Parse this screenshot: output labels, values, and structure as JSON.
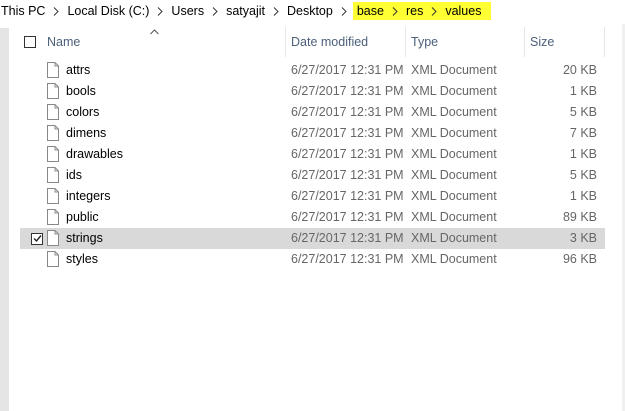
{
  "breadcrumb": {
    "items": [
      "This PC",
      "Local Disk (C:)",
      "Users",
      "satyajit",
      "Desktop",
      "base",
      "res",
      "values"
    ],
    "highlight_color": "#ffff33"
  },
  "columns": {
    "name": "Name",
    "date": "Date modified",
    "type": "Type",
    "size": "Size"
  },
  "sort": {
    "column": "name",
    "direction": "ascending"
  },
  "files": [
    {
      "name": "attrs",
      "date": "6/27/2017 12:31 PM",
      "type": "XML Document",
      "size": "20 KB",
      "selected": false
    },
    {
      "name": "bools",
      "date": "6/27/2017 12:31 PM",
      "type": "XML Document",
      "size": "1 KB",
      "selected": false
    },
    {
      "name": "colors",
      "date": "6/27/2017 12:31 PM",
      "type": "XML Document",
      "size": "5 KB",
      "selected": false
    },
    {
      "name": "dimens",
      "date": "6/27/2017 12:31 PM",
      "type": "XML Document",
      "size": "7 KB",
      "selected": false
    },
    {
      "name": "drawables",
      "date": "6/27/2017 12:31 PM",
      "type": "XML Document",
      "size": "1 KB",
      "selected": false
    },
    {
      "name": "ids",
      "date": "6/27/2017 12:31 PM",
      "type": "XML Document",
      "size": "5 KB",
      "selected": false
    },
    {
      "name": "integers",
      "date": "6/27/2017 12:31 PM",
      "type": "XML Document",
      "size": "1 KB",
      "selected": false
    },
    {
      "name": "public",
      "date": "6/27/2017 12:31 PM",
      "type": "XML Document",
      "size": "89 KB",
      "selected": false
    },
    {
      "name": "strings",
      "date": "6/27/2017 12:31 PM",
      "type": "XML Document",
      "size": "3 KB",
      "selected": true
    },
    {
      "name": "styles",
      "date": "6/27/2017 12:31 PM",
      "type": "XML Document",
      "size": "96 KB",
      "selected": false
    }
  ],
  "colors": {
    "selected_row": "#d9d9d9",
    "header_text": "#4c607a",
    "secondary_text": "#666666"
  }
}
